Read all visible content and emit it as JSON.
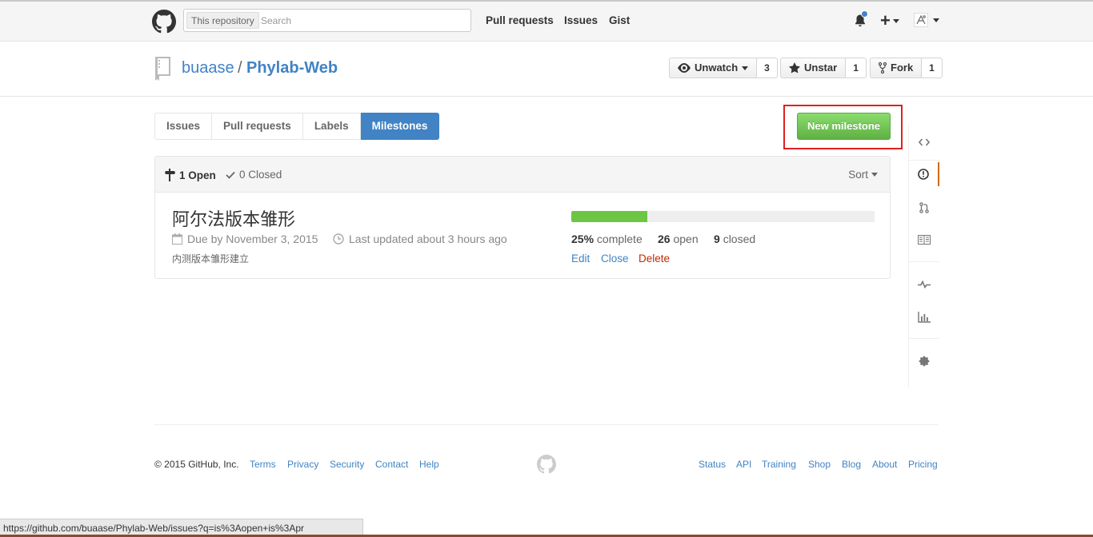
{
  "header": {
    "search_scope": "This repository",
    "search_placeholder": "Search",
    "nav": [
      "Pull requests",
      "Issues",
      "Gist"
    ],
    "plus_label": "+",
    "notification_unread_color": "#4183c4"
  },
  "repo": {
    "owner": "buaase",
    "separator": "/",
    "name": "Phylab-Web",
    "watch": {
      "label": "Unwatch",
      "count": "3"
    },
    "star": {
      "label": "Unstar",
      "count": "1"
    },
    "fork": {
      "label": "Fork",
      "count": "1"
    }
  },
  "subnav": {
    "items": [
      "Issues",
      "Pull requests",
      "Labels",
      "Milestones"
    ],
    "selected": "Milestones"
  },
  "new_milestone_label": "New milestone",
  "table": {
    "open_label": "1 Open",
    "closed_label": "0 Closed",
    "sort_label": "Sort"
  },
  "milestone": {
    "title": "阿尔法版本雏形",
    "due": "Due by November 3, 2015",
    "updated": "Last updated about 3 hours ago",
    "description": "内测版本雏形建立",
    "progress_percent": 25,
    "complete_pct": "25%",
    "complete_text": "complete",
    "open_count": "26",
    "open_text": "open",
    "closed_count": "9",
    "closed_text": "closed",
    "actions": {
      "edit": "Edit",
      "close": "Close",
      "delete": "Delete"
    }
  },
  "sidebar": {
    "items": [
      "code-icon",
      "issues-icon",
      "pull-request-icon",
      "wiki-icon",
      "pulse-icon",
      "graphs-icon",
      "settings-icon"
    ],
    "selected": "issues-icon"
  },
  "footer": {
    "copyright": "© 2015 GitHub, Inc.",
    "left_links": [
      "Terms",
      "Privacy",
      "Security",
      "Contact",
      "Help"
    ],
    "right_links": [
      "Status",
      "API",
      "Training",
      "Shop",
      "Blog",
      "About",
      "Pricing"
    ]
  },
  "status_url": "https://github.com/buaase/Phylab-Web/issues?q=is%3Aopen+is%3Apr",
  "colors": {
    "link": "#4183c4",
    "accent_selected": "#4183c4",
    "success": "#6cc644",
    "danger": "#bd2c00",
    "highlight_box": "#e02020"
  }
}
